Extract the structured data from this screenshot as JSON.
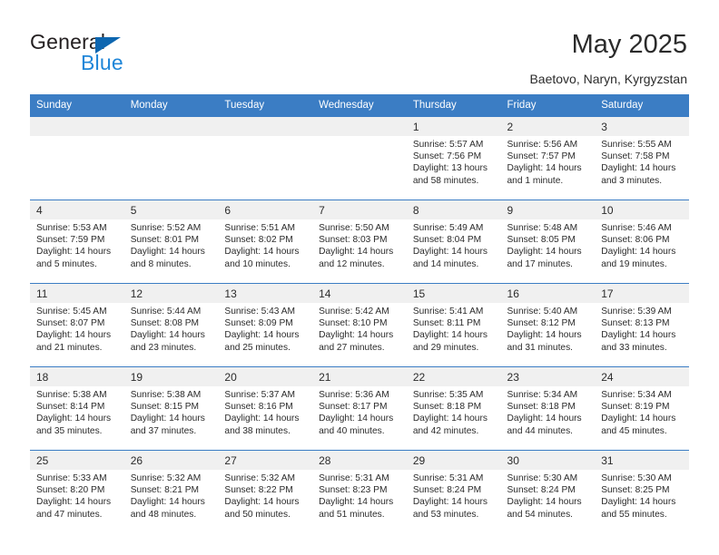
{
  "brand": {
    "name_part1": "General",
    "name_part2": "Blue",
    "triangle_icon": "blue-triangle-logo-icon",
    "accent_color": "#1f86d8",
    "header_color": "#3b7dc4"
  },
  "header": {
    "title": "May 2025",
    "subtitle": "Baetovo, Naryn, Kyrgyzstan"
  },
  "weekday_headers": [
    "Sunday",
    "Monday",
    "Tuesday",
    "Wednesday",
    "Thursday",
    "Friday",
    "Saturday"
  ],
  "labels": {
    "sunrise": "Sunrise:",
    "sunset": "Sunset:",
    "daylight": "Daylight:"
  },
  "weeks": [
    [
      {
        "day": "",
        "sunrise": "",
        "sunset": "",
        "daylight_line1": "",
        "daylight_line2": "",
        "empty": true
      },
      {
        "day": "",
        "sunrise": "",
        "sunset": "",
        "daylight_line1": "",
        "daylight_line2": "",
        "empty": true
      },
      {
        "day": "",
        "sunrise": "",
        "sunset": "",
        "daylight_line1": "",
        "daylight_line2": "",
        "empty": true
      },
      {
        "day": "",
        "sunrise": "",
        "sunset": "",
        "daylight_line1": "",
        "daylight_line2": "",
        "empty": true
      },
      {
        "day": "1",
        "sunrise": "Sunrise: 5:57 AM",
        "sunset": "Sunset: 7:56 PM",
        "daylight_line1": "Daylight: 13 hours",
        "daylight_line2": "and 58 minutes."
      },
      {
        "day": "2",
        "sunrise": "Sunrise: 5:56 AM",
        "sunset": "Sunset: 7:57 PM",
        "daylight_line1": "Daylight: 14 hours",
        "daylight_line2": "and 1 minute."
      },
      {
        "day": "3",
        "sunrise": "Sunrise: 5:55 AM",
        "sunset": "Sunset: 7:58 PM",
        "daylight_line1": "Daylight: 14 hours",
        "daylight_line2": "and 3 minutes."
      }
    ],
    [
      {
        "day": "4",
        "sunrise": "Sunrise: 5:53 AM",
        "sunset": "Sunset: 7:59 PM",
        "daylight_line1": "Daylight: 14 hours",
        "daylight_line2": "and 5 minutes."
      },
      {
        "day": "5",
        "sunrise": "Sunrise: 5:52 AM",
        "sunset": "Sunset: 8:01 PM",
        "daylight_line1": "Daylight: 14 hours",
        "daylight_line2": "and 8 minutes."
      },
      {
        "day": "6",
        "sunrise": "Sunrise: 5:51 AM",
        "sunset": "Sunset: 8:02 PM",
        "daylight_line1": "Daylight: 14 hours",
        "daylight_line2": "and 10 minutes."
      },
      {
        "day": "7",
        "sunrise": "Sunrise: 5:50 AM",
        "sunset": "Sunset: 8:03 PM",
        "daylight_line1": "Daylight: 14 hours",
        "daylight_line2": "and 12 minutes."
      },
      {
        "day": "8",
        "sunrise": "Sunrise: 5:49 AM",
        "sunset": "Sunset: 8:04 PM",
        "daylight_line1": "Daylight: 14 hours",
        "daylight_line2": "and 14 minutes."
      },
      {
        "day": "9",
        "sunrise": "Sunrise: 5:48 AM",
        "sunset": "Sunset: 8:05 PM",
        "daylight_line1": "Daylight: 14 hours",
        "daylight_line2": "and 17 minutes."
      },
      {
        "day": "10",
        "sunrise": "Sunrise: 5:46 AM",
        "sunset": "Sunset: 8:06 PM",
        "daylight_line1": "Daylight: 14 hours",
        "daylight_line2": "and 19 minutes."
      }
    ],
    [
      {
        "day": "11",
        "sunrise": "Sunrise: 5:45 AM",
        "sunset": "Sunset: 8:07 PM",
        "daylight_line1": "Daylight: 14 hours",
        "daylight_line2": "and 21 minutes."
      },
      {
        "day": "12",
        "sunrise": "Sunrise: 5:44 AM",
        "sunset": "Sunset: 8:08 PM",
        "daylight_line1": "Daylight: 14 hours",
        "daylight_line2": "and 23 minutes."
      },
      {
        "day": "13",
        "sunrise": "Sunrise: 5:43 AM",
        "sunset": "Sunset: 8:09 PM",
        "daylight_line1": "Daylight: 14 hours",
        "daylight_line2": "and 25 minutes."
      },
      {
        "day": "14",
        "sunrise": "Sunrise: 5:42 AM",
        "sunset": "Sunset: 8:10 PM",
        "daylight_line1": "Daylight: 14 hours",
        "daylight_line2": "and 27 minutes."
      },
      {
        "day": "15",
        "sunrise": "Sunrise: 5:41 AM",
        "sunset": "Sunset: 8:11 PM",
        "daylight_line1": "Daylight: 14 hours",
        "daylight_line2": "and 29 minutes."
      },
      {
        "day": "16",
        "sunrise": "Sunrise: 5:40 AM",
        "sunset": "Sunset: 8:12 PM",
        "daylight_line1": "Daylight: 14 hours",
        "daylight_line2": "and 31 minutes."
      },
      {
        "day": "17",
        "sunrise": "Sunrise: 5:39 AM",
        "sunset": "Sunset: 8:13 PM",
        "daylight_line1": "Daylight: 14 hours",
        "daylight_line2": "and 33 minutes."
      }
    ],
    [
      {
        "day": "18",
        "sunrise": "Sunrise: 5:38 AM",
        "sunset": "Sunset: 8:14 PM",
        "daylight_line1": "Daylight: 14 hours",
        "daylight_line2": "and 35 minutes."
      },
      {
        "day": "19",
        "sunrise": "Sunrise: 5:38 AM",
        "sunset": "Sunset: 8:15 PM",
        "daylight_line1": "Daylight: 14 hours",
        "daylight_line2": "and 37 minutes."
      },
      {
        "day": "20",
        "sunrise": "Sunrise: 5:37 AM",
        "sunset": "Sunset: 8:16 PM",
        "daylight_line1": "Daylight: 14 hours",
        "daylight_line2": "and 38 minutes."
      },
      {
        "day": "21",
        "sunrise": "Sunrise: 5:36 AM",
        "sunset": "Sunset: 8:17 PM",
        "daylight_line1": "Daylight: 14 hours",
        "daylight_line2": "and 40 minutes."
      },
      {
        "day": "22",
        "sunrise": "Sunrise: 5:35 AM",
        "sunset": "Sunset: 8:18 PM",
        "daylight_line1": "Daylight: 14 hours",
        "daylight_line2": "and 42 minutes."
      },
      {
        "day": "23",
        "sunrise": "Sunrise: 5:34 AM",
        "sunset": "Sunset: 8:18 PM",
        "daylight_line1": "Daylight: 14 hours",
        "daylight_line2": "and 44 minutes."
      },
      {
        "day": "24",
        "sunrise": "Sunrise: 5:34 AM",
        "sunset": "Sunset: 8:19 PM",
        "daylight_line1": "Daylight: 14 hours",
        "daylight_line2": "and 45 minutes."
      }
    ],
    [
      {
        "day": "25",
        "sunrise": "Sunrise: 5:33 AM",
        "sunset": "Sunset: 8:20 PM",
        "daylight_line1": "Daylight: 14 hours",
        "daylight_line2": "and 47 minutes."
      },
      {
        "day": "26",
        "sunrise": "Sunrise: 5:32 AM",
        "sunset": "Sunset: 8:21 PM",
        "daylight_line1": "Daylight: 14 hours",
        "daylight_line2": "and 48 minutes."
      },
      {
        "day": "27",
        "sunrise": "Sunrise: 5:32 AM",
        "sunset": "Sunset: 8:22 PM",
        "daylight_line1": "Daylight: 14 hours",
        "daylight_line2": "and 50 minutes."
      },
      {
        "day": "28",
        "sunrise": "Sunrise: 5:31 AM",
        "sunset": "Sunset: 8:23 PM",
        "daylight_line1": "Daylight: 14 hours",
        "daylight_line2": "and 51 minutes."
      },
      {
        "day": "29",
        "sunrise": "Sunrise: 5:31 AM",
        "sunset": "Sunset: 8:24 PM",
        "daylight_line1": "Daylight: 14 hours",
        "daylight_line2": "and 53 minutes."
      },
      {
        "day": "30",
        "sunrise": "Sunrise: 5:30 AM",
        "sunset": "Sunset: 8:24 PM",
        "daylight_line1": "Daylight: 14 hours",
        "daylight_line2": "and 54 minutes."
      },
      {
        "day": "31",
        "sunrise": "Sunrise: 5:30 AM",
        "sunset": "Sunset: 8:25 PM",
        "daylight_line1": "Daylight: 14 hours",
        "daylight_line2": "and 55 minutes."
      }
    ]
  ]
}
